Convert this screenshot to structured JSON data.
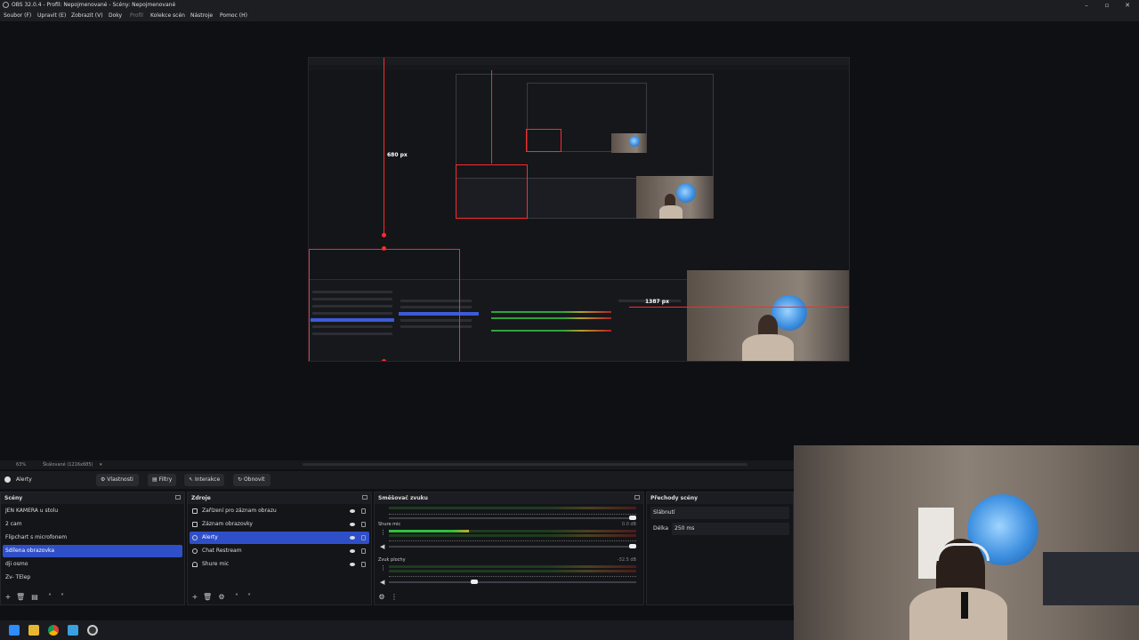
{
  "window": {
    "title": "OBS 32.0.4 - Profil: Nepojmenované - Scény: Nepojmenované",
    "controls": [
      "–",
      "▫",
      "✕"
    ]
  },
  "menu": [
    "Soubor (F)",
    "Upravit (E)",
    "Zobrazit (V)",
    "Doky",
    "Profil",
    "Kolekce scén",
    "Nástroje",
    "Pomoc (H)"
  ],
  "preview": {
    "measure_vertical": "680 px",
    "measure_horizontal": "1387 px"
  },
  "status": {
    "zoom": "63%",
    "scale": "Škálované (1216x685)"
  },
  "context_bar": {
    "source_name": "Alerty",
    "buttons": [
      "Vlastnosti",
      "Filtry",
      "Interakce",
      "Obnovit"
    ]
  },
  "scenes": {
    "title": "Scény",
    "items": [
      "JEN KAMERA u stolu",
      "2 cam",
      "Flipchart s microfonem",
      "Sdílena obrazovka",
      "dji osmo",
      "Zv- TElep"
    ],
    "selected_index": 3
  },
  "sources": {
    "title": "Zdroje",
    "items": [
      "Zařízení pro záznam obrazu",
      "Záznam obrazovky",
      "Alerty",
      "Chat Restream",
      "Shure mic"
    ],
    "selected_index": 2
  },
  "mixer": {
    "title": "Směšovač zvuku",
    "channels": [
      {
        "name": "",
        "db": "",
        "level": 0.0,
        "volume": 1.0
      },
      {
        "name": "Shure mic",
        "db": "0.0 dB",
        "level": 0.32,
        "volume": 1.0
      },
      {
        "name": "Zvuk plochy",
        "db": "-32.5 dB",
        "level": 0.0,
        "volume": 0.35
      }
    ],
    "scale": [
      "-60",
      "-55",
      "-50",
      "-45",
      "-40",
      "-35",
      "-30",
      "-25",
      "-20",
      "-15",
      "-10",
      "-5",
      "0"
    ]
  },
  "transitions": {
    "title": "Přechody scény",
    "type": "Slábnutí",
    "duration_label": "Délka",
    "duration_value": "250 ms"
  },
  "colors": {
    "selection": "#2f4fc9",
    "measure_red": "#ff2a2a",
    "meter_green": "#2fbf3c",
    "meter_yellow": "#c9a727",
    "meter_red": "#b12424"
  },
  "taskbar_icons": [
    "windows-start-icon",
    "file-explorer-icon",
    "chrome-icon",
    "photos-icon",
    "obs-icon"
  ]
}
